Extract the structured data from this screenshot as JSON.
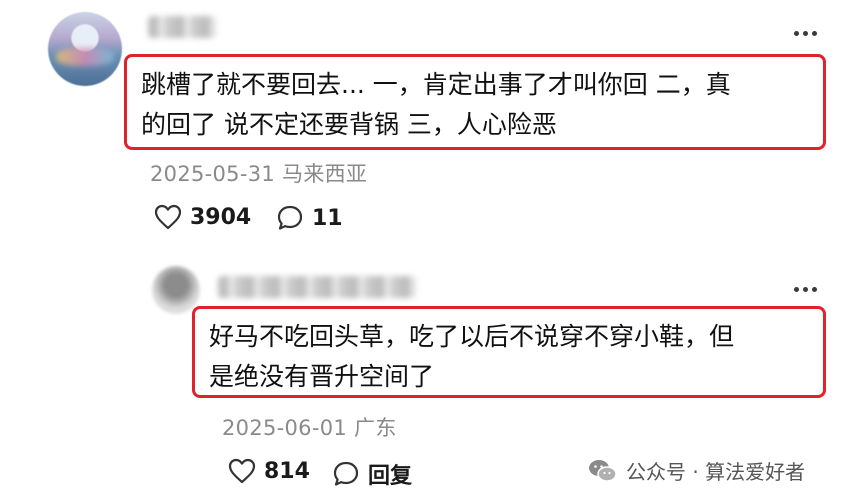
{
  "comment": {
    "text_line1": "跳槽了就不要回去... 一，肯定出事了才叫你回 二，真",
    "text_line2": "的回了 说不定还要背锅 三，人心险恶",
    "date_location": "2025-05-31 马来西亚",
    "likes": "3904",
    "replies": "11"
  },
  "reply": {
    "text_line1": "好马不吃回头草，吃了以后不说穿不穿小鞋，但",
    "text_line2": "是绝没有晋升空间了",
    "date_location": "2025-06-01 广东",
    "likes": "814",
    "reply_label": "回复"
  },
  "watermark": {
    "text": "公众号 · 算法爱好者"
  },
  "colors": {
    "highlight_border": "#e0232a",
    "meta_text": "#8a8a8a"
  }
}
